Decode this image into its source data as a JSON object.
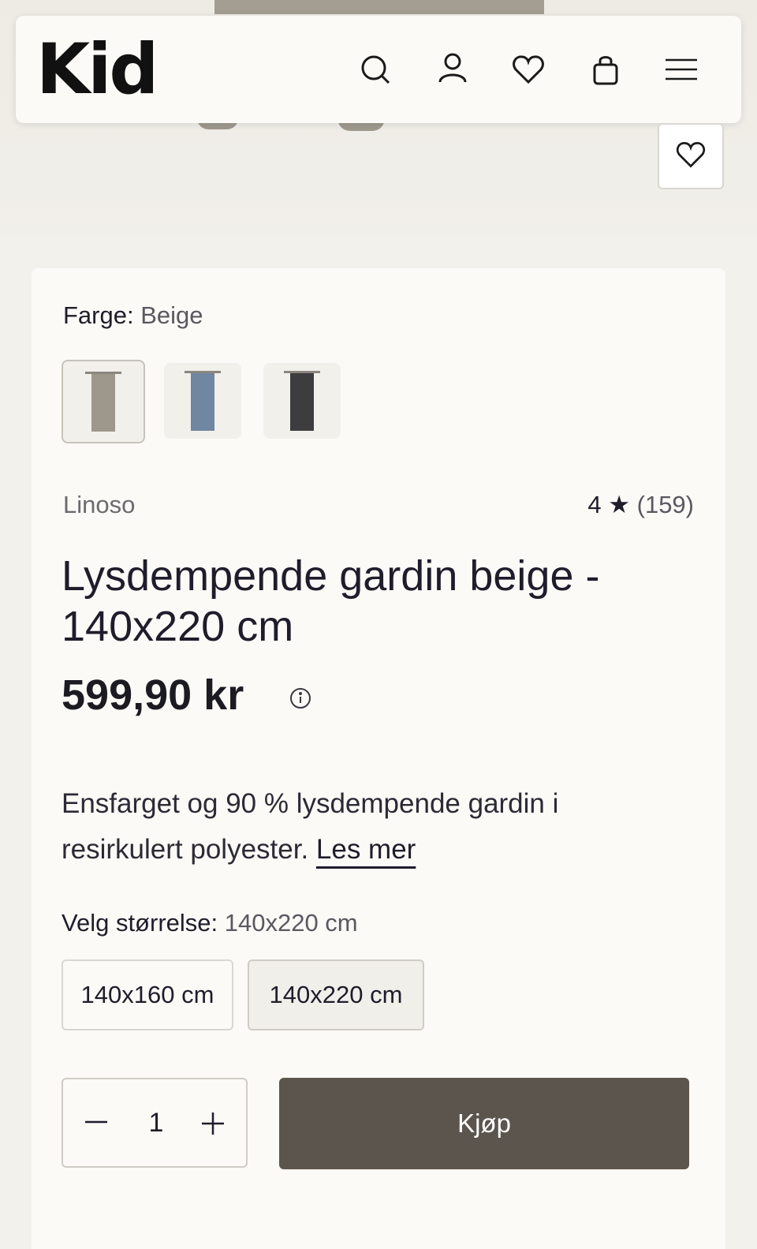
{
  "header": {
    "logo": "Kid",
    "icons": [
      "search-icon",
      "user-icon",
      "heart-icon",
      "bag-icon",
      "menu-icon"
    ]
  },
  "product": {
    "color_label": "Farge:",
    "color_value": "Beige",
    "swatches": [
      {
        "name": "Beige",
        "color": "#9e978b"
      },
      {
        "name": "Blå",
        "color": "#6f87a0"
      },
      {
        "name": "Grå",
        "color": "#3d3d3f"
      }
    ],
    "brand": "Linoso",
    "rating_value": "4",
    "rating_star": "★",
    "rating_count": "(159)",
    "title": "Lysdempende gardin beige - 140x220 cm",
    "price": "599,90 kr",
    "description": "Ensfarget og 90 % lysdempende gardin i resirkulert polyester.",
    "read_more": "Les mer",
    "size_label": "Velg størrelse:",
    "size_value": "140x220 cm",
    "sizes": [
      "140x160 cm",
      "140x220 cm"
    ],
    "quantity": "1",
    "buy_label": "Kjøp"
  },
  "colors": {
    "buy_button": "#5c554d",
    "card_bg": "#fbfaf6",
    "page_bg": "#f3f1ec"
  }
}
